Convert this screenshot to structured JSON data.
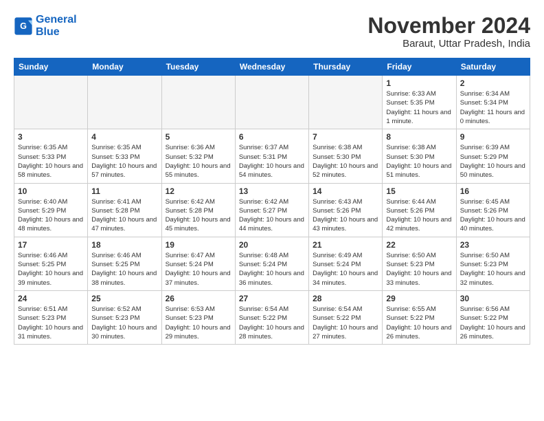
{
  "logo": {
    "line1": "General",
    "line2": "Blue"
  },
  "title": "November 2024",
  "subtitle": "Baraut, Uttar Pradesh, India",
  "weekdays": [
    "Sunday",
    "Monday",
    "Tuesday",
    "Wednesday",
    "Thursday",
    "Friday",
    "Saturday"
  ],
  "weeks": [
    [
      {
        "day": "",
        "empty": true
      },
      {
        "day": "",
        "empty": true
      },
      {
        "day": "",
        "empty": true
      },
      {
        "day": "",
        "empty": true
      },
      {
        "day": "",
        "empty": true
      },
      {
        "day": "1",
        "sunrise": "Sunrise: 6:33 AM",
        "sunset": "Sunset: 5:35 PM",
        "daylight": "Daylight: 11 hours and 1 minute."
      },
      {
        "day": "2",
        "sunrise": "Sunrise: 6:34 AM",
        "sunset": "Sunset: 5:34 PM",
        "daylight": "Daylight: 11 hours and 0 minutes."
      }
    ],
    [
      {
        "day": "3",
        "sunrise": "Sunrise: 6:35 AM",
        "sunset": "Sunset: 5:33 PM",
        "daylight": "Daylight: 10 hours and 58 minutes."
      },
      {
        "day": "4",
        "sunrise": "Sunrise: 6:35 AM",
        "sunset": "Sunset: 5:33 PM",
        "daylight": "Daylight: 10 hours and 57 minutes."
      },
      {
        "day": "5",
        "sunrise": "Sunrise: 6:36 AM",
        "sunset": "Sunset: 5:32 PM",
        "daylight": "Daylight: 10 hours and 55 minutes."
      },
      {
        "day": "6",
        "sunrise": "Sunrise: 6:37 AM",
        "sunset": "Sunset: 5:31 PM",
        "daylight": "Daylight: 10 hours and 54 minutes."
      },
      {
        "day": "7",
        "sunrise": "Sunrise: 6:38 AM",
        "sunset": "Sunset: 5:30 PM",
        "daylight": "Daylight: 10 hours and 52 minutes."
      },
      {
        "day": "8",
        "sunrise": "Sunrise: 6:38 AM",
        "sunset": "Sunset: 5:30 PM",
        "daylight": "Daylight: 10 hours and 51 minutes."
      },
      {
        "day": "9",
        "sunrise": "Sunrise: 6:39 AM",
        "sunset": "Sunset: 5:29 PM",
        "daylight": "Daylight: 10 hours and 50 minutes."
      }
    ],
    [
      {
        "day": "10",
        "sunrise": "Sunrise: 6:40 AM",
        "sunset": "Sunset: 5:29 PM",
        "daylight": "Daylight: 10 hours and 48 minutes."
      },
      {
        "day": "11",
        "sunrise": "Sunrise: 6:41 AM",
        "sunset": "Sunset: 5:28 PM",
        "daylight": "Daylight: 10 hours and 47 minutes."
      },
      {
        "day": "12",
        "sunrise": "Sunrise: 6:42 AM",
        "sunset": "Sunset: 5:28 PM",
        "daylight": "Daylight: 10 hours and 45 minutes."
      },
      {
        "day": "13",
        "sunrise": "Sunrise: 6:42 AM",
        "sunset": "Sunset: 5:27 PM",
        "daylight": "Daylight: 10 hours and 44 minutes."
      },
      {
        "day": "14",
        "sunrise": "Sunrise: 6:43 AM",
        "sunset": "Sunset: 5:26 PM",
        "daylight": "Daylight: 10 hours and 43 minutes."
      },
      {
        "day": "15",
        "sunrise": "Sunrise: 6:44 AM",
        "sunset": "Sunset: 5:26 PM",
        "daylight": "Daylight: 10 hours and 42 minutes."
      },
      {
        "day": "16",
        "sunrise": "Sunrise: 6:45 AM",
        "sunset": "Sunset: 5:26 PM",
        "daylight": "Daylight: 10 hours and 40 minutes."
      }
    ],
    [
      {
        "day": "17",
        "sunrise": "Sunrise: 6:46 AM",
        "sunset": "Sunset: 5:25 PM",
        "daylight": "Daylight: 10 hours and 39 minutes."
      },
      {
        "day": "18",
        "sunrise": "Sunrise: 6:46 AM",
        "sunset": "Sunset: 5:25 PM",
        "daylight": "Daylight: 10 hours and 38 minutes."
      },
      {
        "day": "19",
        "sunrise": "Sunrise: 6:47 AM",
        "sunset": "Sunset: 5:24 PM",
        "daylight": "Daylight: 10 hours and 37 minutes."
      },
      {
        "day": "20",
        "sunrise": "Sunrise: 6:48 AM",
        "sunset": "Sunset: 5:24 PM",
        "daylight": "Daylight: 10 hours and 36 minutes."
      },
      {
        "day": "21",
        "sunrise": "Sunrise: 6:49 AM",
        "sunset": "Sunset: 5:24 PM",
        "daylight": "Daylight: 10 hours and 34 minutes."
      },
      {
        "day": "22",
        "sunrise": "Sunrise: 6:50 AM",
        "sunset": "Sunset: 5:23 PM",
        "daylight": "Daylight: 10 hours and 33 minutes."
      },
      {
        "day": "23",
        "sunrise": "Sunrise: 6:50 AM",
        "sunset": "Sunset: 5:23 PM",
        "daylight": "Daylight: 10 hours and 32 minutes."
      }
    ],
    [
      {
        "day": "24",
        "sunrise": "Sunrise: 6:51 AM",
        "sunset": "Sunset: 5:23 PM",
        "daylight": "Daylight: 10 hours and 31 minutes."
      },
      {
        "day": "25",
        "sunrise": "Sunrise: 6:52 AM",
        "sunset": "Sunset: 5:23 PM",
        "daylight": "Daylight: 10 hours and 30 minutes."
      },
      {
        "day": "26",
        "sunrise": "Sunrise: 6:53 AM",
        "sunset": "Sunset: 5:23 PM",
        "daylight": "Daylight: 10 hours and 29 minutes."
      },
      {
        "day": "27",
        "sunrise": "Sunrise: 6:54 AM",
        "sunset": "Sunset: 5:22 PM",
        "daylight": "Daylight: 10 hours and 28 minutes."
      },
      {
        "day": "28",
        "sunrise": "Sunrise: 6:54 AM",
        "sunset": "Sunset: 5:22 PM",
        "daylight": "Daylight: 10 hours and 27 minutes."
      },
      {
        "day": "29",
        "sunrise": "Sunrise: 6:55 AM",
        "sunset": "Sunset: 5:22 PM",
        "daylight": "Daylight: 10 hours and 26 minutes."
      },
      {
        "day": "30",
        "sunrise": "Sunrise: 6:56 AM",
        "sunset": "Sunset: 5:22 PM",
        "daylight": "Daylight: 10 hours and 26 minutes."
      }
    ]
  ]
}
